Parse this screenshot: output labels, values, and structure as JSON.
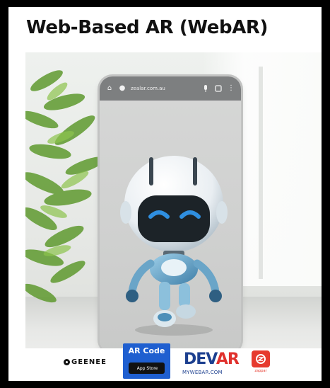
{
  "title": "Web-Based AR (WebAR)",
  "browser": {
    "url": "zealar.com.au",
    "home_icon": "home-icon",
    "lock_icon": "lock-icon",
    "mic_icon": "microphone-icon",
    "tabs_icon": "tabs-icon",
    "menu_icon": "more-vertical-icon"
  },
  "scene": {
    "subject": "robot-3d-model"
  },
  "logos": {
    "geenee": "GEENEE",
    "arcode": "AR Code",
    "appstore": "App Store",
    "devar_d": "DEV",
    "devar_ar": "AR",
    "devar_sub": "MYWEBAR.COM",
    "zappar": "zappar"
  },
  "colors": {
    "arcode_blue": "#1f5fd0",
    "devar_blue": "#1c3f8f",
    "devar_red": "#e0312d",
    "zappar_red": "#e63a2e",
    "robot_eye": "#2f8fe0"
  }
}
